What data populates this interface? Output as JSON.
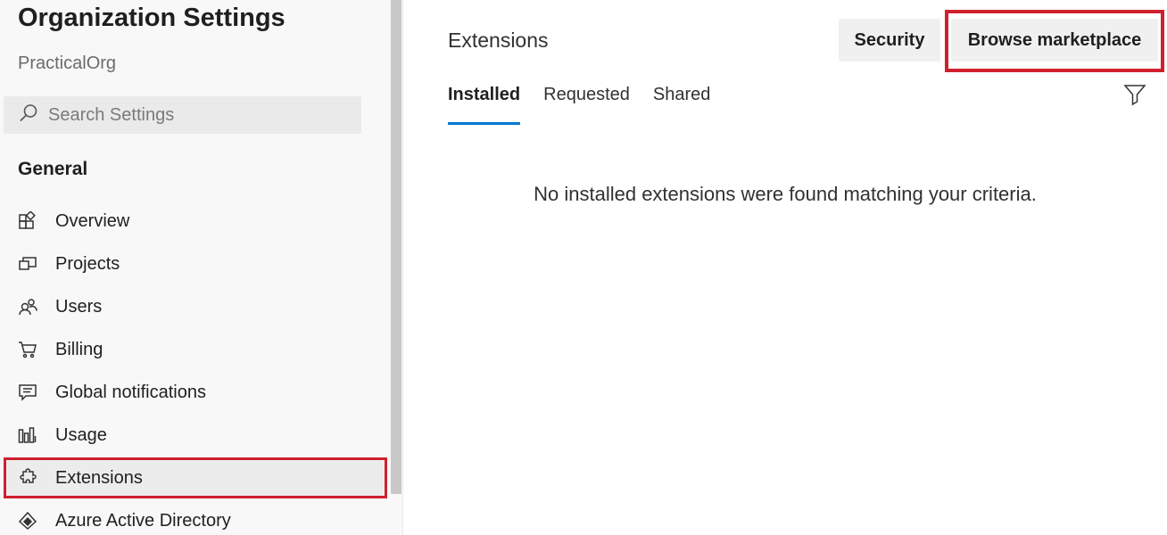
{
  "sidebar": {
    "title": "Organization Settings",
    "org_name": "PracticalOrg",
    "search": {
      "placeholder": "Search Settings",
      "icon": "search-icon"
    },
    "section_title": "General",
    "items": [
      {
        "label": "Overview",
        "icon": "overview-icon"
      },
      {
        "label": "Projects",
        "icon": "projects-icon"
      },
      {
        "label": "Users",
        "icon": "users-icon"
      },
      {
        "label": "Billing",
        "icon": "cart-icon"
      },
      {
        "label": "Global notifications",
        "icon": "notifications-icon"
      },
      {
        "label": "Usage",
        "icon": "usage-chart-icon"
      },
      {
        "label": "Extensions",
        "icon": "puzzle-icon",
        "selected": true
      },
      {
        "label": "Azure Active Directory",
        "icon": "azure-ad-icon"
      }
    ]
  },
  "main": {
    "title": "Extensions",
    "buttons": {
      "security": "Security",
      "browse": "Browse marketplace"
    },
    "tabs": [
      {
        "label": "Installed",
        "active": true
      },
      {
        "label": "Requested"
      },
      {
        "label": "Shared"
      }
    ],
    "filter_icon": "filter-icon",
    "empty_message": "No installed extensions were found matching your criteria."
  },
  "colors": {
    "highlight": "#d0202e",
    "accent": "#0078d4",
    "sidebar_bg": "#f8f8f8"
  }
}
